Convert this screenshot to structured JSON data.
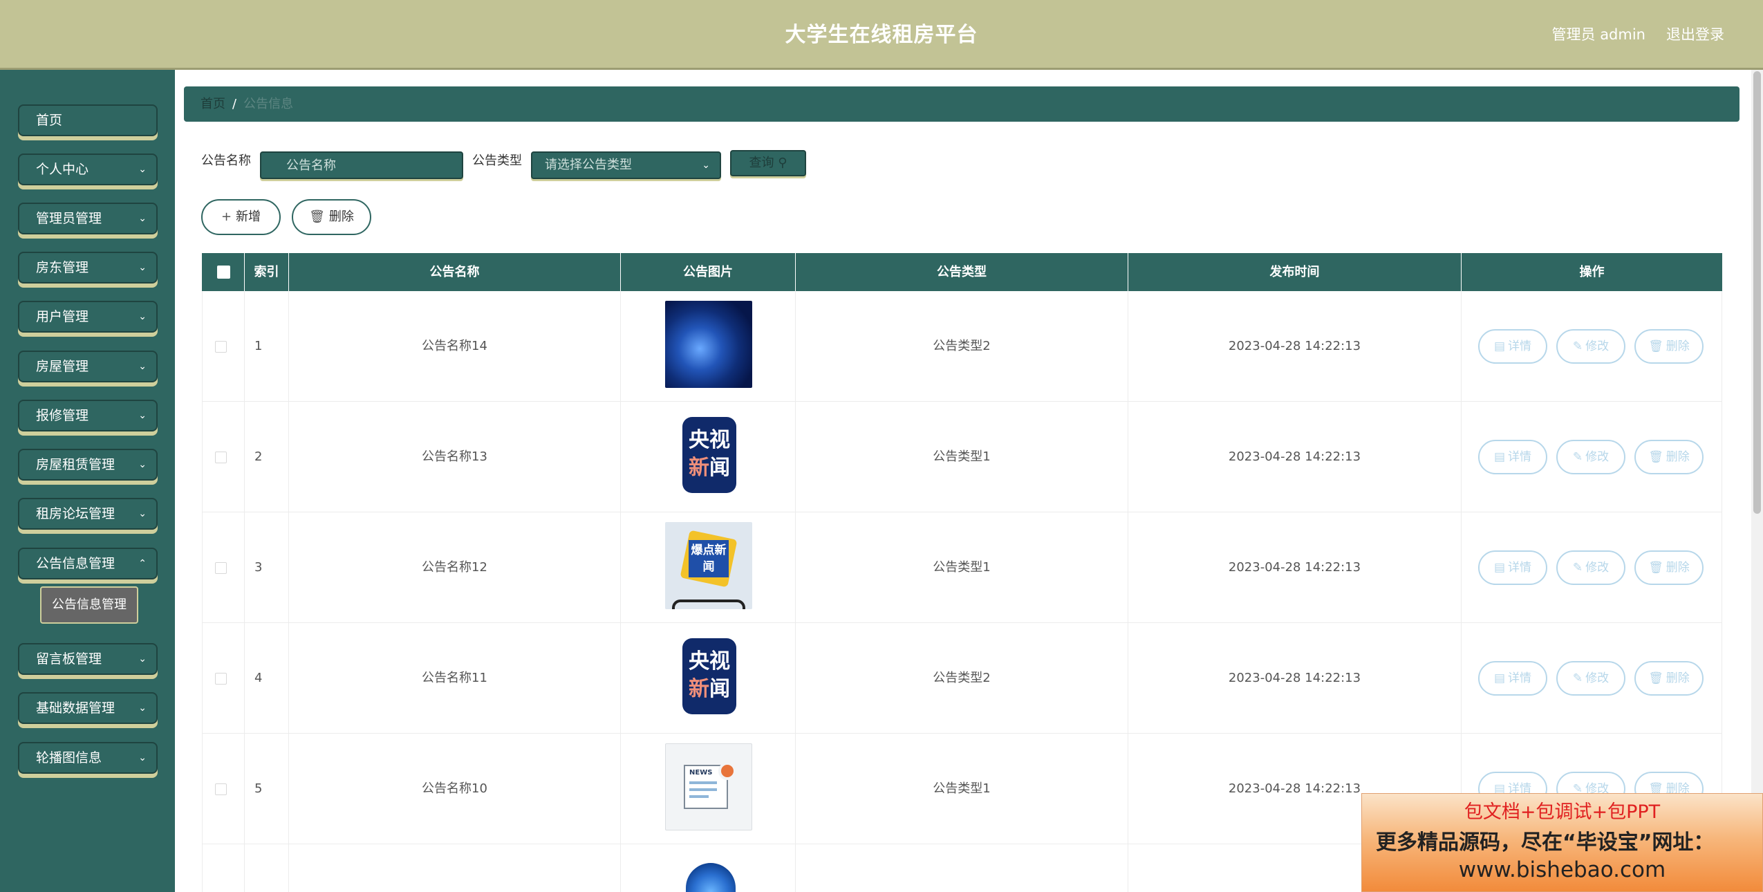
{
  "header": {
    "title": "大学生在线租房平台",
    "user": "管理员 admin",
    "logout": "退出登录"
  },
  "sidebar": {
    "items": [
      {
        "label": "首页"
      },
      {
        "label": "个人中心"
      },
      {
        "label": "管理员管理"
      },
      {
        "label": "房东管理"
      },
      {
        "label": "用户管理"
      },
      {
        "label": "房屋管理"
      },
      {
        "label": "报修管理"
      },
      {
        "label": "房屋租赁管理"
      },
      {
        "label": "租房论坛管理"
      },
      {
        "label": "公告信息管理"
      },
      {
        "label": "留言板管理"
      },
      {
        "label": "基础数据管理"
      },
      {
        "label": "轮播图信息"
      }
    ],
    "submenu_active": "公告信息管理"
  },
  "breadcrumb": {
    "home": "首页",
    "separator": "/",
    "current": "公告信息"
  },
  "search": {
    "name_label": "公告名称",
    "name_placeholder": "公告名称",
    "type_label": "公告类型",
    "type_placeholder": "请选择公告类型",
    "query_label": "查询"
  },
  "actions": {
    "add_label": "新增",
    "delete_label": "删除"
  },
  "table": {
    "columns": [
      "索引",
      "公告名称",
      "公告图片",
      "公告类型",
      "发布时间",
      "操作"
    ],
    "rows": [
      {
        "index": "1",
        "name": "公告名称14",
        "image": "globe-news",
        "type": "公告类型2",
        "time": "2023-04-28 14:22:13"
      },
      {
        "index": "2",
        "name": "公告名称13",
        "image": "cctv-news",
        "type": "公告类型1",
        "time": "2023-04-28 14:22:13"
      },
      {
        "index": "3",
        "name": "公告名称12",
        "image": "breaking-news",
        "type": "公告类型1",
        "time": "2023-04-28 14:22:13"
      },
      {
        "index": "4",
        "name": "公告名称11",
        "image": "cctv-news",
        "type": "公告类型2",
        "time": "2023-04-28 14:22:13"
      },
      {
        "index": "5",
        "name": "公告名称10",
        "image": "newspaper",
        "type": "公告类型1",
        "time": "2023-04-28 14:22:13"
      }
    ],
    "row_actions": {
      "detail": "详情",
      "edit": "修改",
      "delete": "删除"
    },
    "cctv_text_1": "央视",
    "cctv_text_2a": "新",
    "cctv_text_2b": "闻",
    "burst_text": "爆点新闻",
    "news_text": "NEWS"
  },
  "ad": {
    "line1": "包文档+包调试+包PPT",
    "line2": "更多精品源码，尽在“毕设宝”网址：",
    "line3": "www.bishebao.com"
  },
  "colors": {
    "header_bg": "#c2c395",
    "sidebar_bg": "#2f6661",
    "accent_shadow": "#cfcf9c",
    "op_button": "#b7d7ea"
  }
}
